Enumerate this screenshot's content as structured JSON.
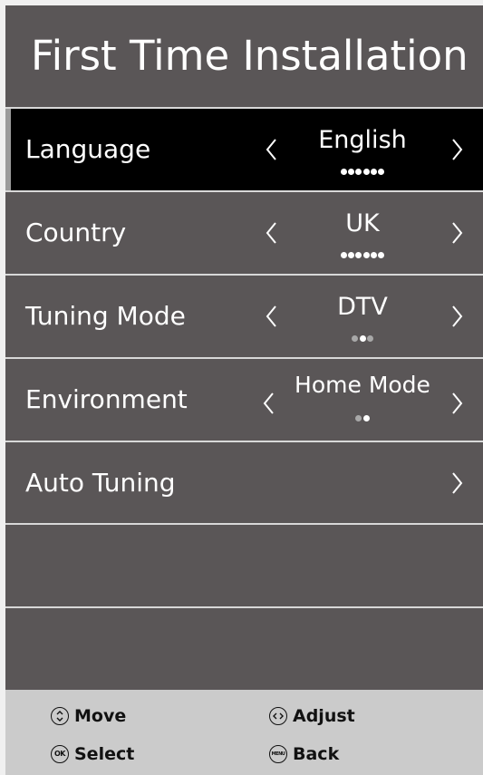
{
  "title": "First Time Installation",
  "colors": {
    "panel_bg": "#5a5657",
    "selected_bg": "#000000",
    "separator": "#d8d8d8",
    "footer_bg": "#cbcbcb",
    "dot_active": "#ffffff",
    "dot_inactive": "#a8a8a8"
  },
  "rows": [
    {
      "label": "Language",
      "value": "English",
      "dots": 6,
      "active_dot": 0,
      "has_left": true,
      "has_right": true,
      "selected": true
    },
    {
      "label": "Country",
      "value": "UK",
      "dots": 6,
      "active_dot": 0,
      "has_left": true,
      "has_right": true,
      "selected": false
    },
    {
      "label": "Tuning Mode",
      "value": "DTV",
      "dots": 3,
      "active_dot": 1,
      "has_left": true,
      "has_right": true,
      "selected": false
    },
    {
      "label": "Environment",
      "value": "Home Mode",
      "dots": 2,
      "active_dot": 1,
      "has_left": true,
      "has_right": true,
      "selected": false
    },
    {
      "label": "Auto Tuning",
      "value": "",
      "dots": 0,
      "active_dot": 0,
      "has_left": false,
      "has_right": true,
      "selected": false
    }
  ],
  "footer": {
    "move": {
      "label": "Move",
      "icon": "up-down-icon"
    },
    "adjust": {
      "label": "Adjust",
      "icon": "left-right-icon"
    },
    "select": {
      "label": "Select",
      "icon": "ok-icon",
      "icon_text": "OK"
    },
    "back": {
      "label": "Back",
      "icon": "menu-icon",
      "icon_text": "MENU"
    }
  }
}
